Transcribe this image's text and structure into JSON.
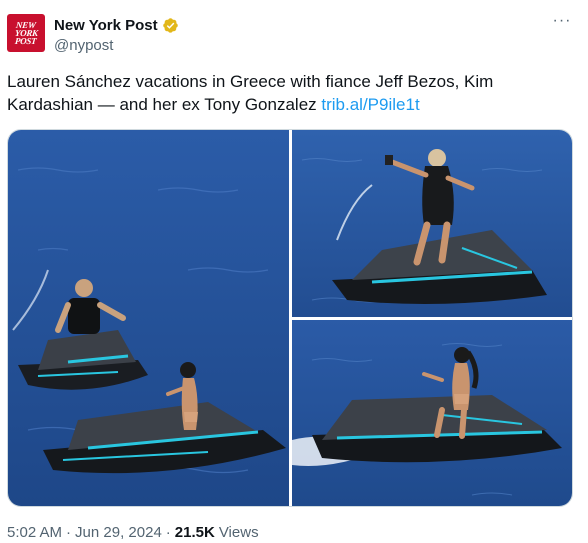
{
  "account": {
    "display_name": "New York Post",
    "handle": "@nypost",
    "avatar_lines": [
      "NEW",
      "YORK",
      "POST"
    ],
    "verified_badge_color": "#e2b719",
    "verified_icon": "verified-badge-icon"
  },
  "menu_icon_label": "···",
  "tweet": {
    "text": "Lauren Sánchez vacations in Greece with fiance Jeff Bezos, Kim Kardashian — and her ex Tony Gonzalez ",
    "link_text": "trib.al/P9ile1t",
    "link_color": "#1d9bf0"
  },
  "media": {
    "count": 3,
    "water_color": "#2a5aa6",
    "accent_color": "#29c6e0"
  },
  "footer": {
    "time": "5:02 AM",
    "separator": "·",
    "date": "Jun 29, 2024",
    "views_count": "21.5K",
    "views_label": "Views"
  }
}
